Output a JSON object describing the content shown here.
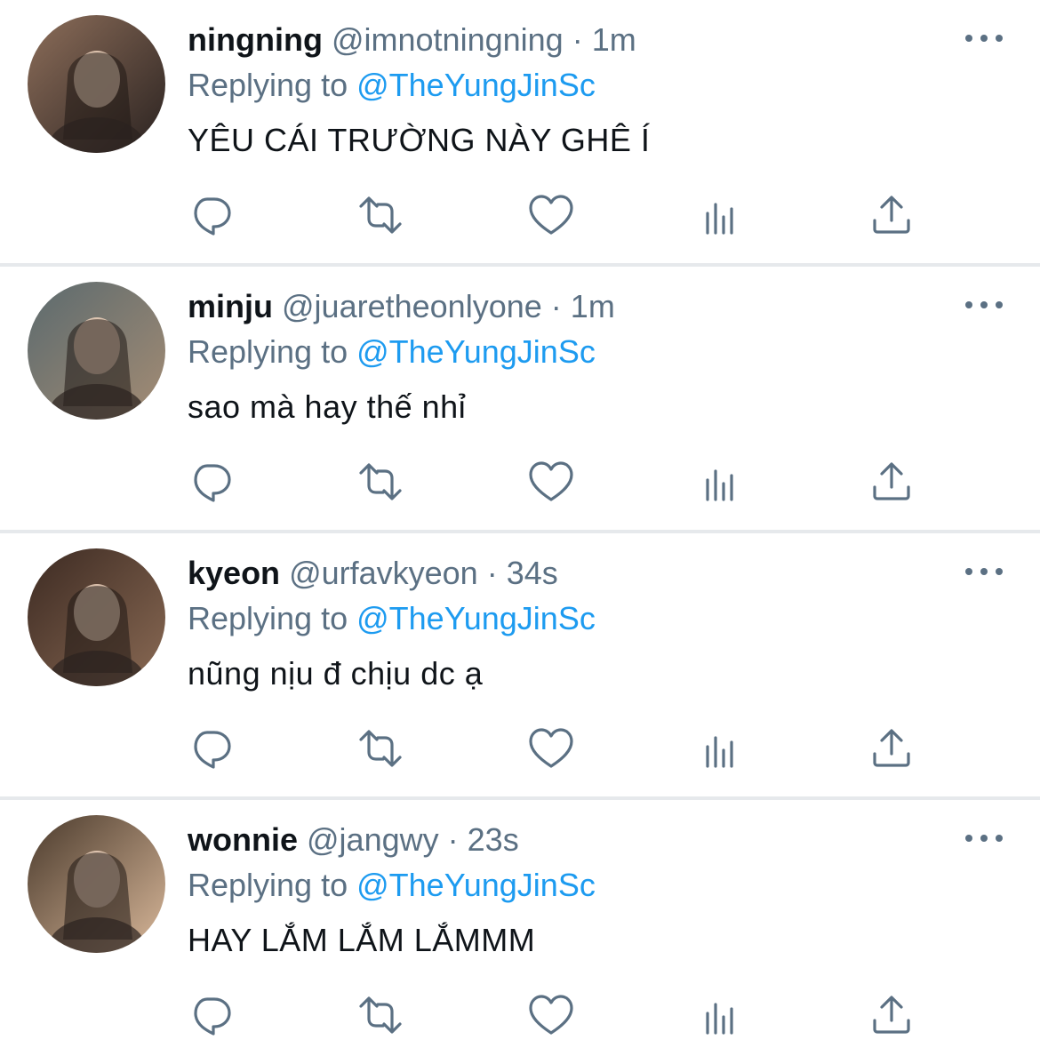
{
  "replying_to_label": "Replying to",
  "tweets": [
    {
      "name": "ningning",
      "handle": "@imnotningning",
      "separator": "·",
      "time": "1m",
      "reply_to": "@TheYungJinSc",
      "text": "YÊU CÁI TRƯỜNG NÀY GHÊ Í",
      "avatar_colors": [
        "#8d6e5a",
        "#2a2220"
      ]
    },
    {
      "name": "minju",
      "handle": "@juaretheonlyone",
      "separator": "·",
      "time": "1m",
      "reply_to": "@TheYungJinSc",
      "text": "sao mà hay thế nhỉ",
      "avatar_colors": [
        "#5b6a6e",
        "#a48c74"
      ]
    },
    {
      "name": "kyeon",
      "handle": "@urfavkyeon",
      "separator": "·",
      "time": "34s",
      "reply_to": "@TheYungJinSc",
      "text": "nũng nịu đ chịu dc ạ",
      "avatar_colors": [
        "#3c2a22",
        "#8a6a54"
      ]
    },
    {
      "name": "wonnie",
      "handle": "@jangwy",
      "separator": "·",
      "time": "23s",
      "reply_to": "@TheYungJinSc",
      "text": "HAY LẮM LẮM LẮMMM",
      "avatar_colors": [
        "#4a3a2c",
        "#d9b89a"
      ]
    }
  ],
  "icons": {
    "more": "more-horizontal-icon",
    "reply": "reply-icon",
    "retweet": "retweet-icon",
    "like": "like-icon",
    "views": "views-icon",
    "share": "share-icon"
  },
  "colors": {
    "text": "#0f1419",
    "secondary": "#5b7083",
    "accent": "#1d9bf0",
    "divider": "#e6e9ec"
  }
}
